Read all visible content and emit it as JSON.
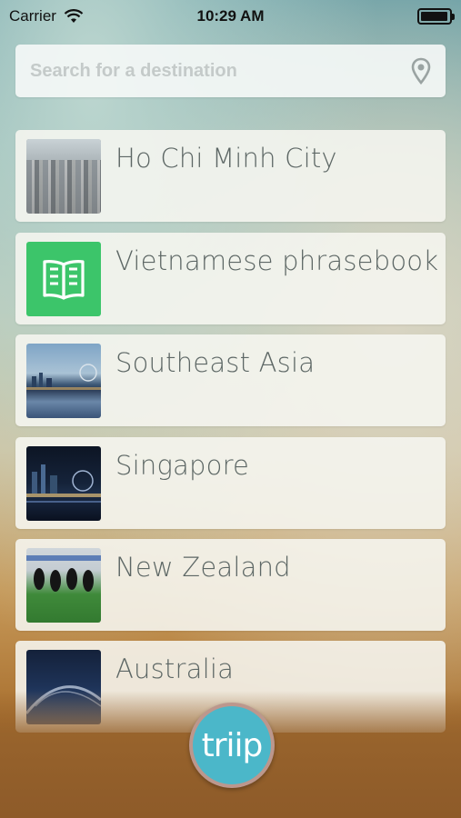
{
  "status_bar": {
    "carrier": "Carrier",
    "time": "10:29 AM",
    "battery_level": 0.95
  },
  "search": {
    "placeholder": "Search for a destination",
    "icon": "location-pin-icon"
  },
  "items": [
    {
      "label": "Ho Chi Minh City",
      "thumbnail": "city-skyline-photo"
    },
    {
      "label": "Vietnamese phrasebook",
      "thumbnail": "book-icon",
      "thumbnail_color": "#3cc56a"
    },
    {
      "label": "Southeast Asia",
      "thumbnail": "marina-skyline-photo"
    },
    {
      "label": "Singapore",
      "thumbnail": "night-skyline-photo"
    },
    {
      "label": "New Zealand",
      "thumbnail": "rugby-team-photo"
    },
    {
      "label": "Australia",
      "thumbnail": "harbour-bridge-photo"
    }
  ],
  "fab": {
    "label": "triip",
    "color": "#4bb7c9"
  }
}
